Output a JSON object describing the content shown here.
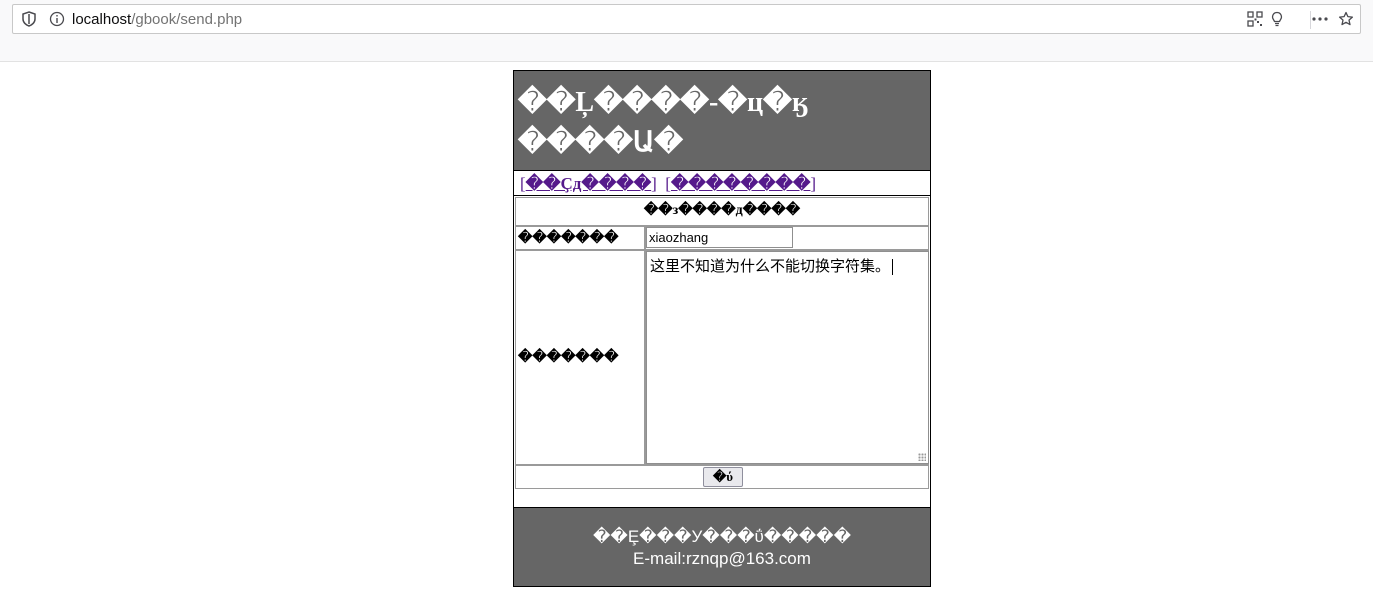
{
  "browser": {
    "url_host": "localhost",
    "url_path": "/gbook/send.php",
    "icons": [
      "shield-icon",
      "info-icon",
      "qr-code-icon",
      "lightbulb-icon",
      "more-icon",
      "star-icon"
    ]
  },
  "header": {
    "title": "��Ļ����-�ц�ӄ����Ա�"
  },
  "nav": {
    "links": [
      "��Ҫд����",
      "��������"
    ]
  },
  "form": {
    "caption": "��з����д����",
    "name_label": "�������",
    "name_value": "xiaozhang",
    "content_label": "�������",
    "content_value": "这里不知道为什么不能切换字符集。",
    "submit_label": "�ύ"
  },
  "footer": {
    "line1": "��Ȩ���У���ΰ�����",
    "line2": "E-mail:rznqp@163.com"
  },
  "colors": {
    "header_bg": "#666666",
    "link": "#551a8b",
    "footer_text": "#ffffff"
  }
}
